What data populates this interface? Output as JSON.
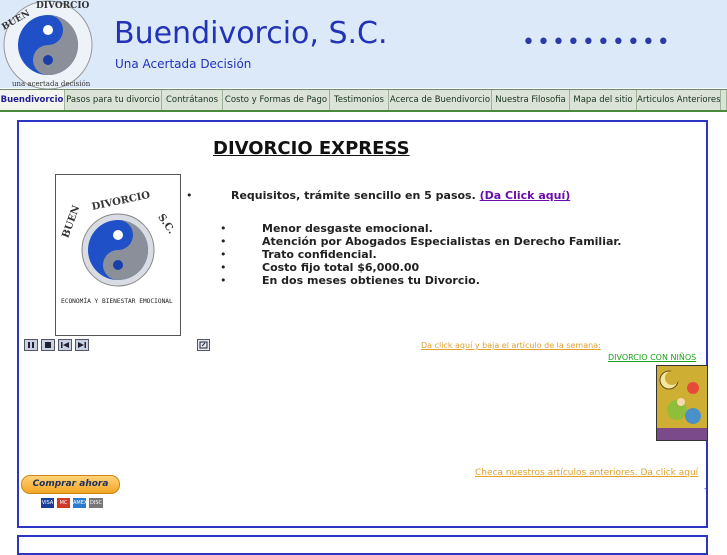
{
  "header": {
    "title": "Buendivorcio, S.C.",
    "tagline": "Una Acertada Decisión",
    "logo_text_top": "BUEN DIVORCIO S.C.",
    "logo_text_bottom": "una acertada decisión"
  },
  "nav": {
    "items": [
      {
        "label": "Buendivorcio",
        "active": true
      },
      {
        "label": "Pasos para tu divorcio",
        "active": false
      },
      {
        "label": "Contrátanos",
        "active": false
      },
      {
        "label": "Costo y Formas de Pago",
        "active": false
      },
      {
        "label": "Testimonios",
        "active": false
      },
      {
        "label": "Acerca de Buendivorcio",
        "active": false
      },
      {
        "label": "Nuestra Filosofia",
        "active": false
      },
      {
        "label": "Mapa del sitio",
        "active": false
      },
      {
        "label": "Articulos Anteriores",
        "active": false
      }
    ]
  },
  "main": {
    "title": "DIVORCIO EXPRESS",
    "requirements_text": "Requisitos, trámite sencillo en 5 pasos.",
    "requirements_link": "(Da Click aquí)",
    "benefits": [
      "Menor desgaste emocional.",
      "Atención por Abogados Especialistas en Derecho Familiar.",
      "Trato confidencial.",
      "Costo fijo total $6,000.00",
      "En dos meses obtienes tu Divorcio."
    ],
    "logo_box_top": "BUEN DIVORCIO S.C.",
    "logo_box_caption": "ECONOMÍA Y BIENESTAR EMOCIONAL",
    "article_link": "Da click aquí y baja el artículo de la semana:",
    "ninos_link": "DIVORCIO CON NIÑOS",
    "previous_link": "Checa nuestros artículos anteriores. Da click aquí",
    "dash": "-",
    "buy_button": "Comprar ahora",
    "cards": [
      "VISA",
      "MC",
      "AMEX",
      "DISC"
    ]
  },
  "colors": {
    "brand_blue": "#2233b5",
    "header_bg": "#dce9f9",
    "nav_bg": "#dbe3d8",
    "border_blue": "#2b35c6",
    "link_orange": "#e0a030",
    "link_green": "#1aa01a"
  },
  "icons": [
    "pause-icon",
    "stop-icon",
    "previous-icon",
    "next-icon",
    "fullscreen-icon"
  ]
}
